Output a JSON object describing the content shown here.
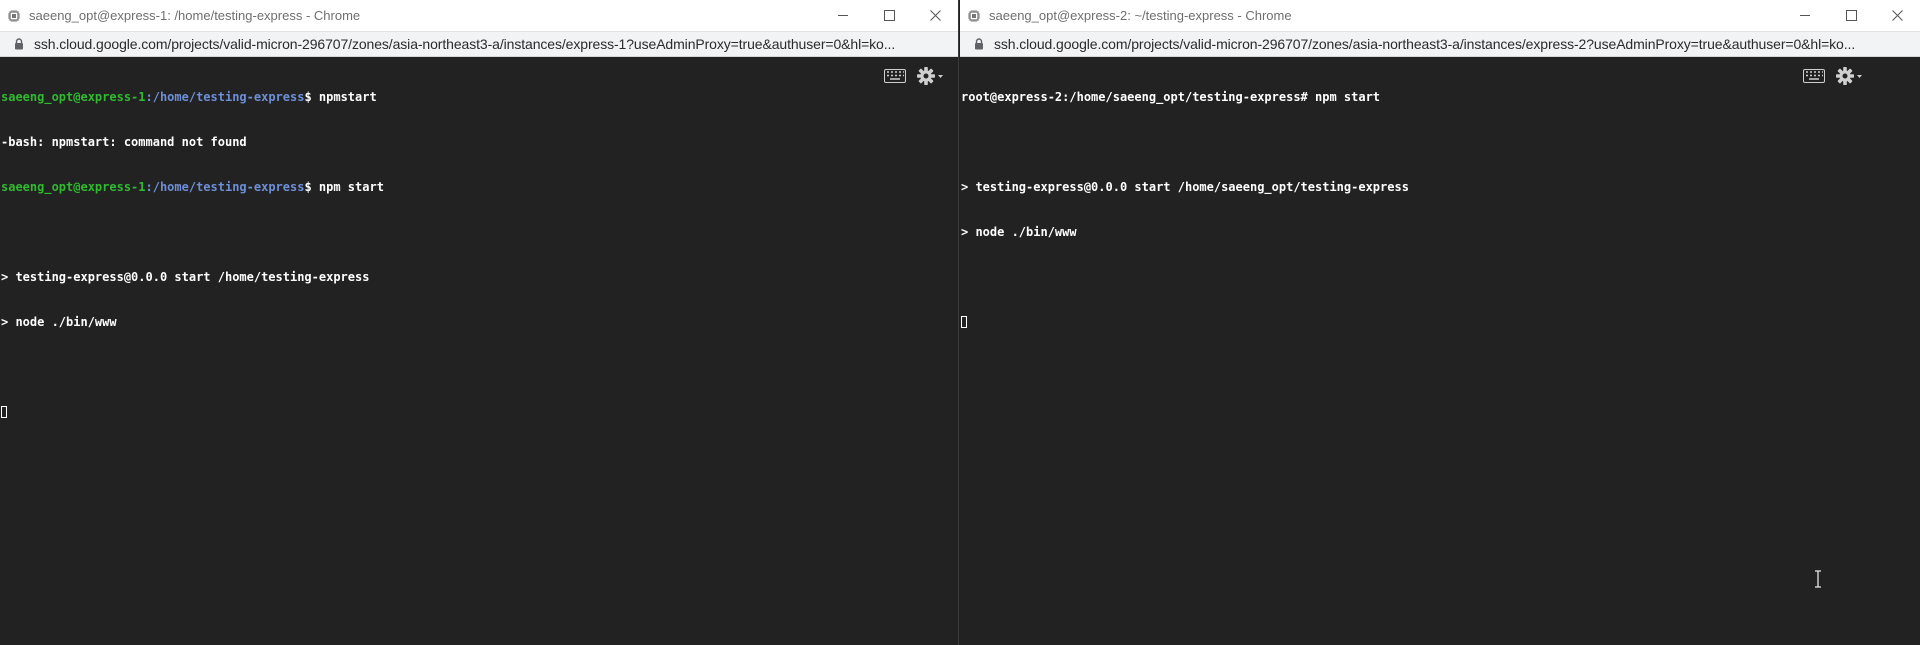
{
  "windows": [
    {
      "title": "saeeng_opt@express-1: /home/testing-express - Chrome",
      "url": "ssh.cloud.google.com/projects/valid-micron-296707/zones/asia-northeast3-a/instances/express-1?useAdminProxy=true&authuser=0&hl=ko...",
      "terminal": {
        "line1_user": "saeeng_opt@express-1",
        "line1_path": ":/home/testing-express",
        "line1_cmd": "$ npmstart",
        "line2": "-bash: npmstart: command not found",
        "line3_user": "saeeng_opt@express-1",
        "line3_path": ":/home/testing-express",
        "line3_cmd": "$ npm start",
        "line5": "> testing-express@0.0.0 start /home/testing-express",
        "line6": "> node ./bin/www"
      }
    },
    {
      "title": "saeeng_opt@express-2: ~/testing-express - Chrome",
      "url": "ssh.cloud.google.com/projects/valid-micron-296707/zones/asia-northeast3-a/instances/express-2?useAdminProxy=true&authuser=0&hl=ko...",
      "terminal": {
        "line1": "root@express-2:/home/saeeng_opt/testing-express# npm start",
        "line3": "> testing-express@0.0.0 start /home/saeeng_opt/testing-express",
        "line4": "> node ./bin/www"
      }
    }
  ],
  "icons": {
    "app": "chip-icon",
    "minimize": "minimize-icon",
    "maximize": "maximize-icon",
    "close": "close-icon",
    "lock": "lock-icon",
    "keyboard": "keyboard-icon",
    "settings": "gear-icon",
    "pointer": "text-cursor-icon"
  },
  "colors": {
    "terminal_bg": "#222222",
    "prompt_user": "#2fba2f",
    "prompt_path": "#6d8fd8",
    "terminal_text": "#ffffff"
  }
}
